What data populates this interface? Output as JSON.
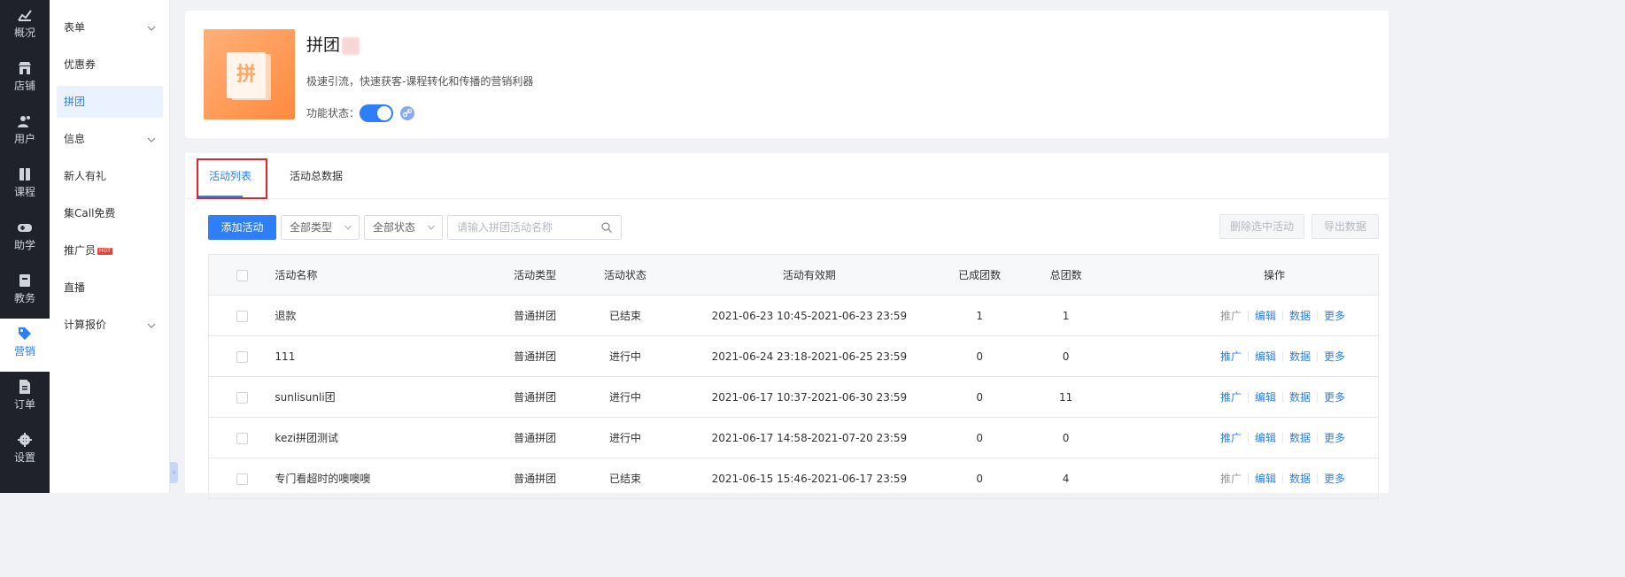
{
  "rail": [
    {
      "label": "概况",
      "icon": "chart-icon"
    },
    {
      "label": "店铺",
      "icon": "store-icon"
    },
    {
      "label": "用户",
      "icon": "users-icon"
    },
    {
      "label": "课程",
      "icon": "book-icon"
    },
    {
      "label": "助学",
      "icon": "gamepad-icon"
    },
    {
      "label": "教务",
      "icon": "clipboard-icon"
    },
    {
      "label": "营销",
      "icon": "tag-icon",
      "active": true
    },
    {
      "label": "订单",
      "icon": "document-icon"
    },
    {
      "label": "设置",
      "icon": "gear-icon"
    }
  ],
  "submenu": [
    {
      "label": "表单",
      "chevron": true
    },
    {
      "label": "优惠券"
    },
    {
      "label": "拼团",
      "active": true
    },
    {
      "label": "信息",
      "chevron": true
    },
    {
      "label": "新人有礼"
    },
    {
      "label": "集Call免费"
    },
    {
      "label": "推广员",
      "badge": "HOT"
    },
    {
      "label": "直播"
    },
    {
      "label": "计算报价",
      "chevron": true
    }
  ],
  "header": {
    "title": "拼团",
    "description": "极速引流，快速获客-课程转化和传播的营销利器",
    "status_label": "功能状态：",
    "logo_char": "拼",
    "enabled": true
  },
  "tabs": [
    "活动列表",
    "活动总数据"
  ],
  "toolbar": {
    "add_label": "添加活动",
    "type_select": "全部类型",
    "status_select": "全部状态",
    "search_placeholder": "请输入拼团活动名称",
    "delete_label": "删除选中活动",
    "export_label": "导出数据"
  },
  "table": {
    "headers": [
      "活动名称",
      "活动类型",
      "活动状态",
      "活动有效期",
      "已成团数",
      "总团数",
      "操作"
    ],
    "rows": [
      {
        "name": "退款",
        "type": "普通拼团",
        "status": "已结束",
        "period": "2021-06-23 10:45-2021-06-23 23:59",
        "formed": "1",
        "total": "1"
      },
      {
        "name": "111",
        "type": "普通拼团",
        "status": "进行中",
        "period": "2021-06-24 23:18-2021-06-25 23:59",
        "formed": "0",
        "total": "0"
      },
      {
        "name": "sunlisunli团",
        "type": "普通拼团",
        "status": "进行中",
        "period": "2021-06-17 10:37-2021-06-30 23:59",
        "formed": "0",
        "total": "11"
      },
      {
        "name": "kezi拼团测试",
        "type": "普通拼团",
        "status": "进行中",
        "period": "2021-06-17 14:58-2021-07-20 23:59",
        "formed": "0",
        "total": "0"
      },
      {
        "name": "专门看超时的噢噢噢",
        "type": "普通拼团",
        "status": "已结束",
        "period": "2021-06-15 15:46-2021-06-17 23:59",
        "formed": "0",
        "total": "4"
      }
    ],
    "ops": [
      "推广",
      "编辑",
      "数据",
      "更多"
    ]
  },
  "colors": {
    "accent": "#2d7ef7",
    "running": "#3fbb2c",
    "ended": "#999999",
    "rail_bg": "#1f2329"
  }
}
